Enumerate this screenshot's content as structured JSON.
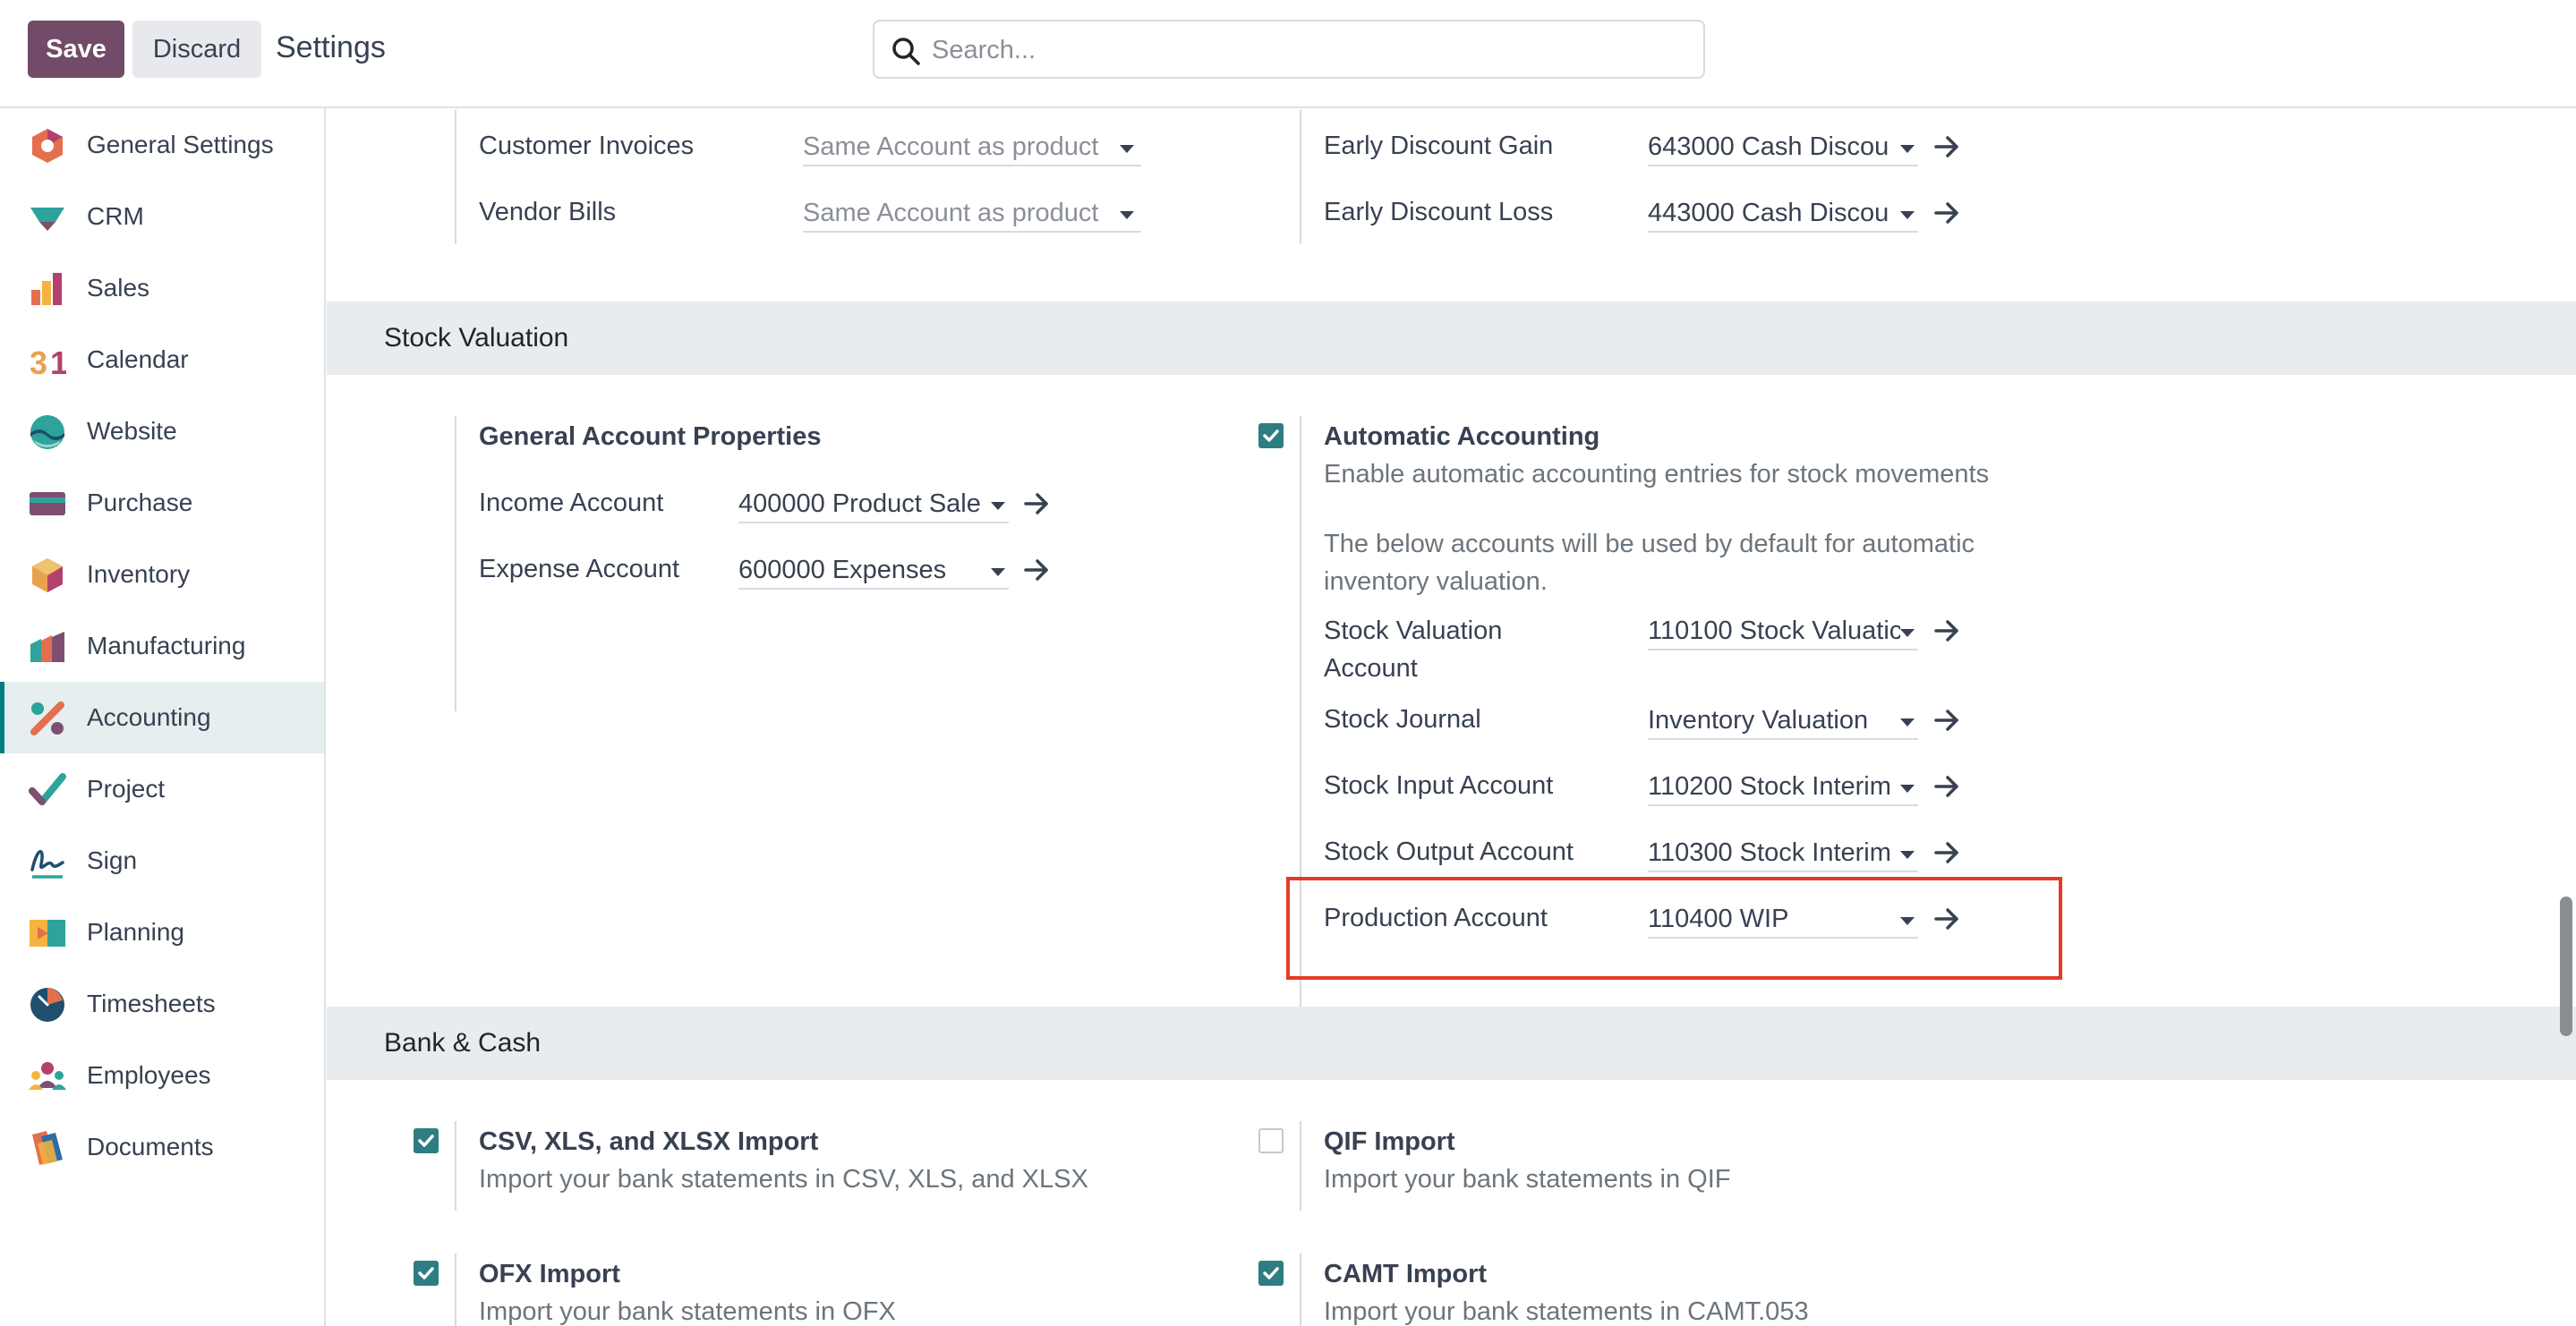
{
  "header": {
    "save_label": "Save",
    "discard_label": "Discard",
    "title": "Settings",
    "search_placeholder": "Search..."
  },
  "sidebar": {
    "items": [
      {
        "label": "General Settings",
        "icon": "general-settings-icon",
        "active": false
      },
      {
        "label": "CRM",
        "icon": "crm-icon",
        "active": false
      },
      {
        "label": "Sales",
        "icon": "sales-icon",
        "active": false
      },
      {
        "label": "Calendar",
        "icon": "calendar-icon",
        "active": false
      },
      {
        "label": "Website",
        "icon": "website-icon",
        "active": false
      },
      {
        "label": "Purchase",
        "icon": "purchase-icon",
        "active": false
      },
      {
        "label": "Inventory",
        "icon": "inventory-icon",
        "active": false
      },
      {
        "label": "Manufacturing",
        "icon": "manufacturing-icon",
        "active": false
      },
      {
        "label": "Accounting",
        "icon": "accounting-icon",
        "active": true
      },
      {
        "label": "Project",
        "icon": "project-icon",
        "active": false
      },
      {
        "label": "Sign",
        "icon": "sign-icon",
        "active": false
      },
      {
        "label": "Planning",
        "icon": "planning-icon",
        "active": false
      },
      {
        "label": "Timesheets",
        "icon": "timesheets-icon",
        "active": false
      },
      {
        "label": "Employees",
        "icon": "employees-icon",
        "active": false
      },
      {
        "label": "Documents",
        "icon": "documents-icon",
        "active": false
      }
    ]
  },
  "top_block": {
    "left": [
      {
        "label": "Customer Invoices",
        "value": "Same Account as product"
      },
      {
        "label": "Vendor Bills",
        "value": "Same Account as product"
      }
    ],
    "right": [
      {
        "label": "Early Discount Gain",
        "value": "643000 Cash Discou"
      },
      {
        "label": "Early Discount Loss",
        "value": "443000 Cash Discou"
      }
    ]
  },
  "stock_valuation": {
    "heading": "Stock Valuation",
    "general": {
      "title": "General Account Properties",
      "income_label": "Income Account",
      "income_value": "400000 Product Sale",
      "expense_label": "Expense Account",
      "expense_value": "600000 Expenses"
    },
    "auto": {
      "title": "Automatic Accounting",
      "checked": true,
      "desc": "Enable automatic accounting entries for stock movements",
      "note": "The below accounts will be used by default for automatic inventory valuation.",
      "fields": [
        {
          "label": "Stock Valuation Account",
          "value": "110100 Stock Valuatic"
        },
        {
          "label": "Stock Journal",
          "value": "Inventory Valuation"
        },
        {
          "label": "Stock Input Account",
          "value": "110200 Stock Interim"
        },
        {
          "label": "Stock Output Account",
          "value": "110300 Stock Interim"
        },
        {
          "label": "Production Account",
          "value": "110400 WIP"
        }
      ]
    }
  },
  "bank_cash": {
    "heading": "Bank & Cash",
    "items": [
      {
        "title": "CSV, XLS, and XLSX Import",
        "desc": "Import your bank statements in CSV, XLS, and XLSX",
        "checked": true
      },
      {
        "title": "QIF Import",
        "desc": "Import your bank statements in QIF",
        "checked": false
      },
      {
        "title": "OFX Import",
        "desc": "Import your bank statements in OFX",
        "checked": true
      },
      {
        "title": "CAMT Import",
        "desc": "Import your bank statements in CAMT.053",
        "checked": true
      }
    ]
  },
  "colors": {
    "brand": "#714b67",
    "checkbox": "#2e7d82",
    "highlight": "#e23c27",
    "section_bg": "#e9ecef"
  }
}
